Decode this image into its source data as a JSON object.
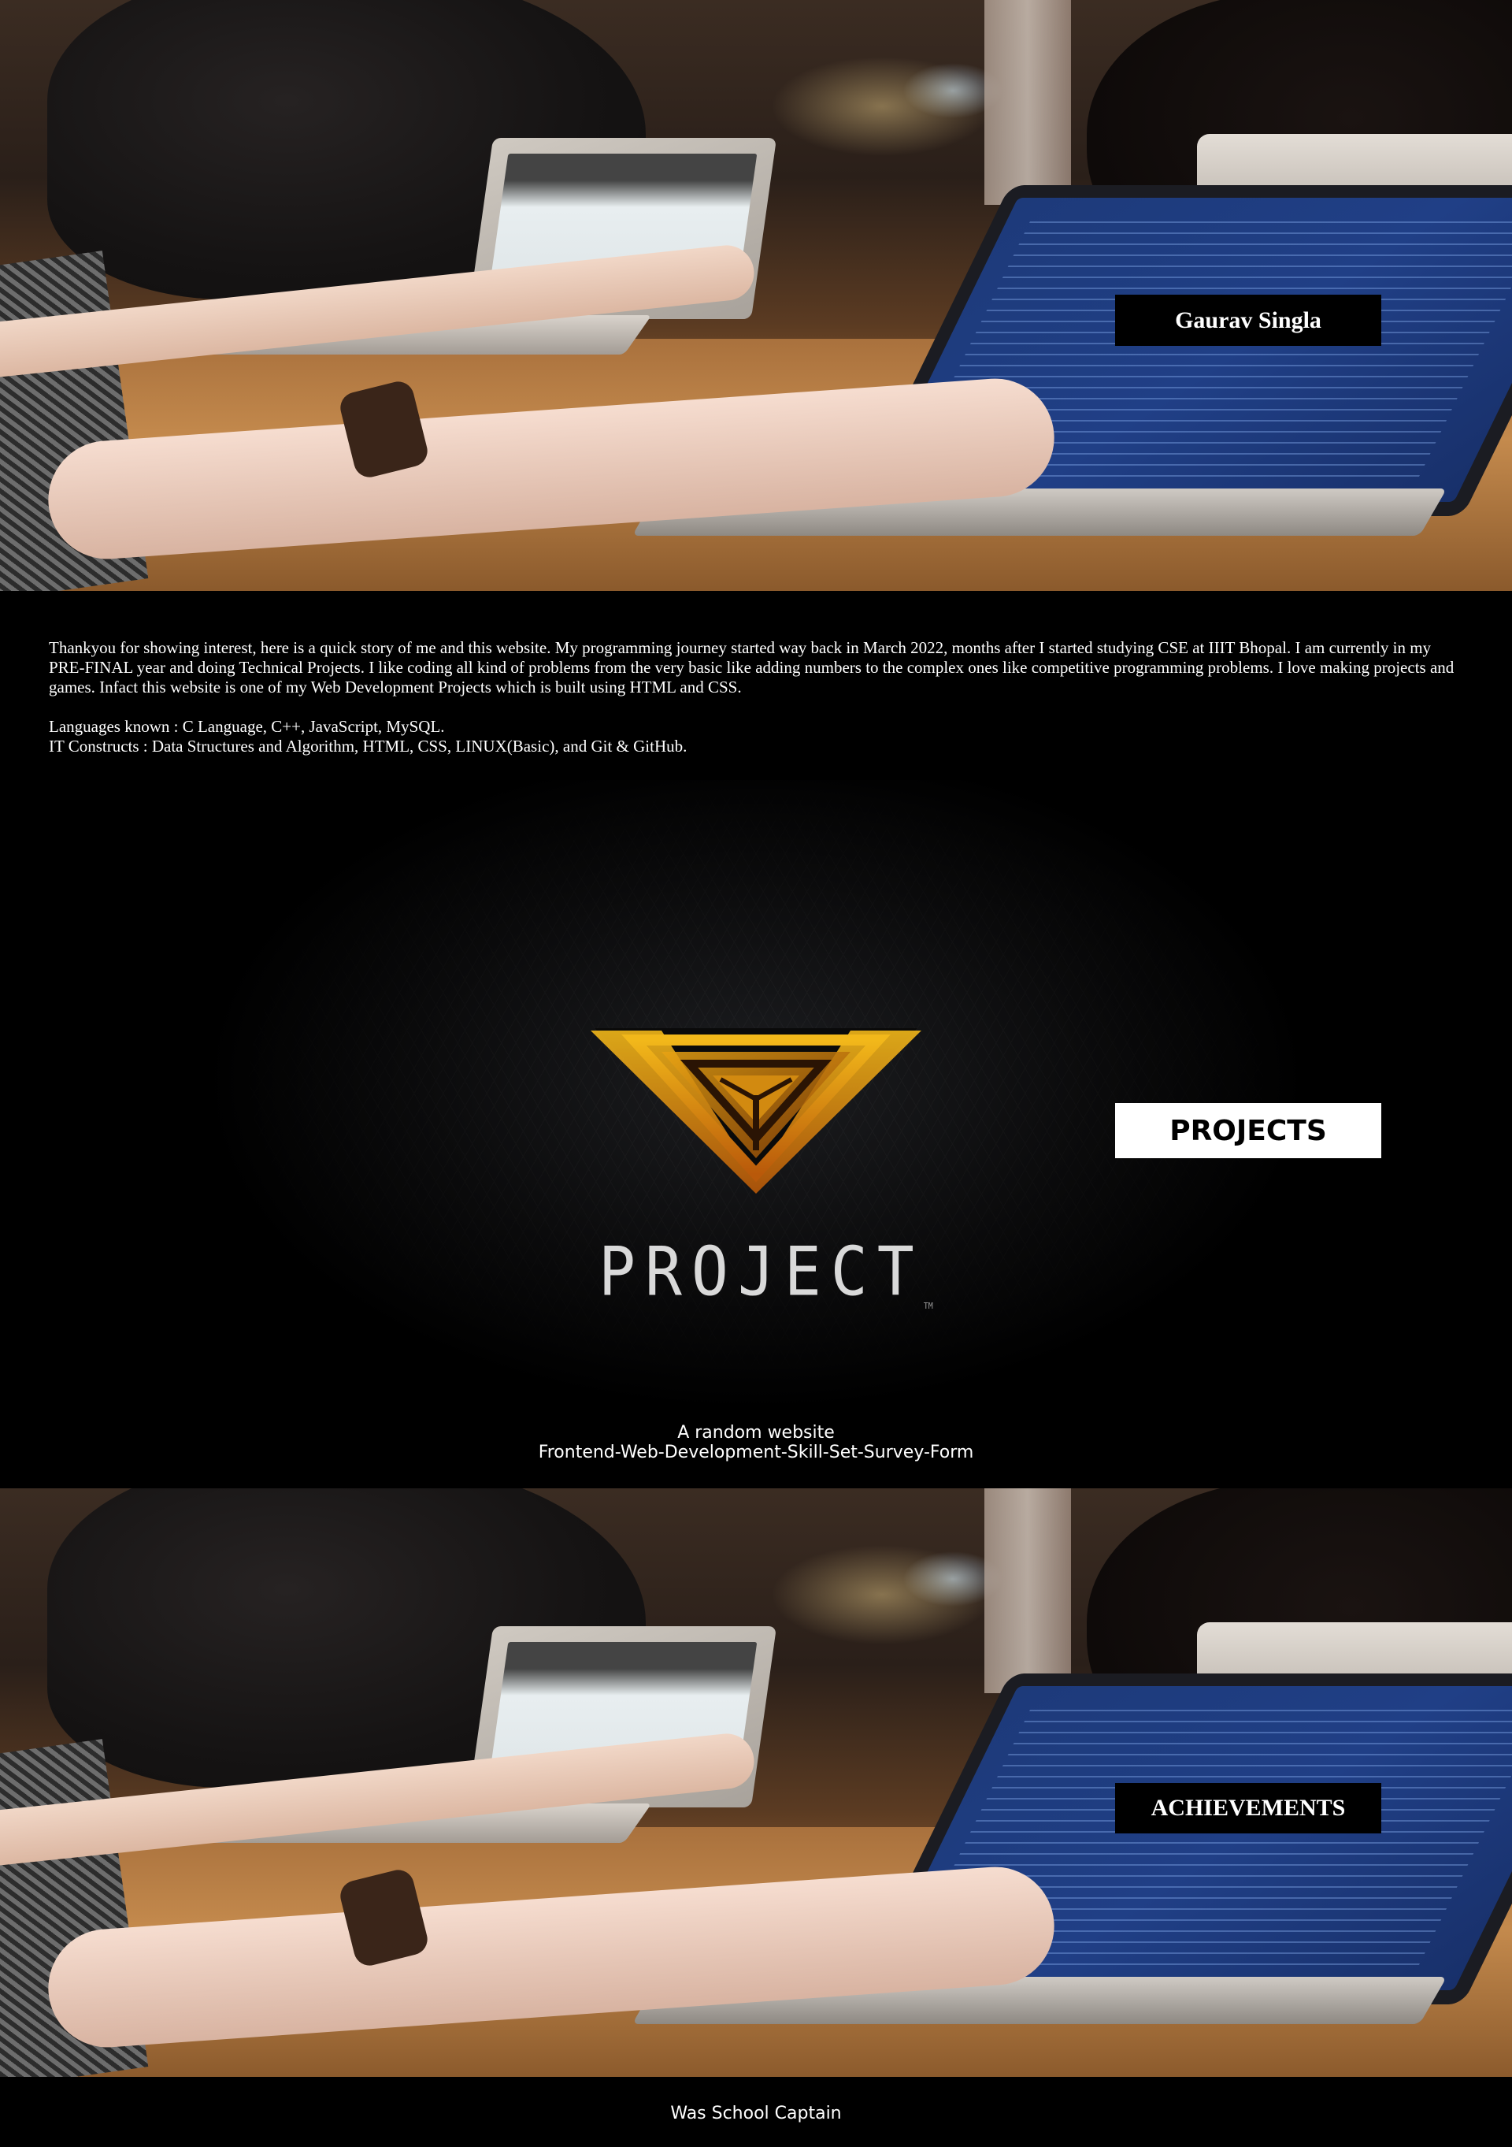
{
  "header": {
    "name_tag": "Gaurav Singla"
  },
  "intro": {
    "story": "Thankyou for showing interest, here is a quick story of me and this website. My programming journey started way back in March 2022, months after I started studying CSE at IIIT Bhopal. I am currently in my PRE-FINAL year and doing Technical Projects. I like coding all kind of problems from the very basic like adding numbers to the complex ones like competitive programming problems. I love making projects and games. Infact this website is one of my Web Development Projects which is built using HTML and CSS.",
    "languages": "Languages known : C Language, C++, JavaScript, MySQL.",
    "constructs": "IT Constructs : Data Structures and Algorithm, HTML, CSS, LINUX(Basic), and Git & GitHub."
  },
  "projects": {
    "heading": "PROJECTS",
    "graphic_word": "PROJECT",
    "graphic_tm": "TM",
    "links": [
      {
        "label": "A random website"
      },
      {
        "label": "Frontend-Web-Development-Skill-Set-Survey-Form"
      }
    ]
  },
  "achievements": {
    "heading": "ACHIEVEMENTS",
    "items": [
      {
        "label": "Was School Captain"
      }
    ]
  },
  "colors": {
    "background": "#000000",
    "text": "#ffffff",
    "logo_gold": "#e3a614",
    "logo_orange": "#c96a0c"
  }
}
